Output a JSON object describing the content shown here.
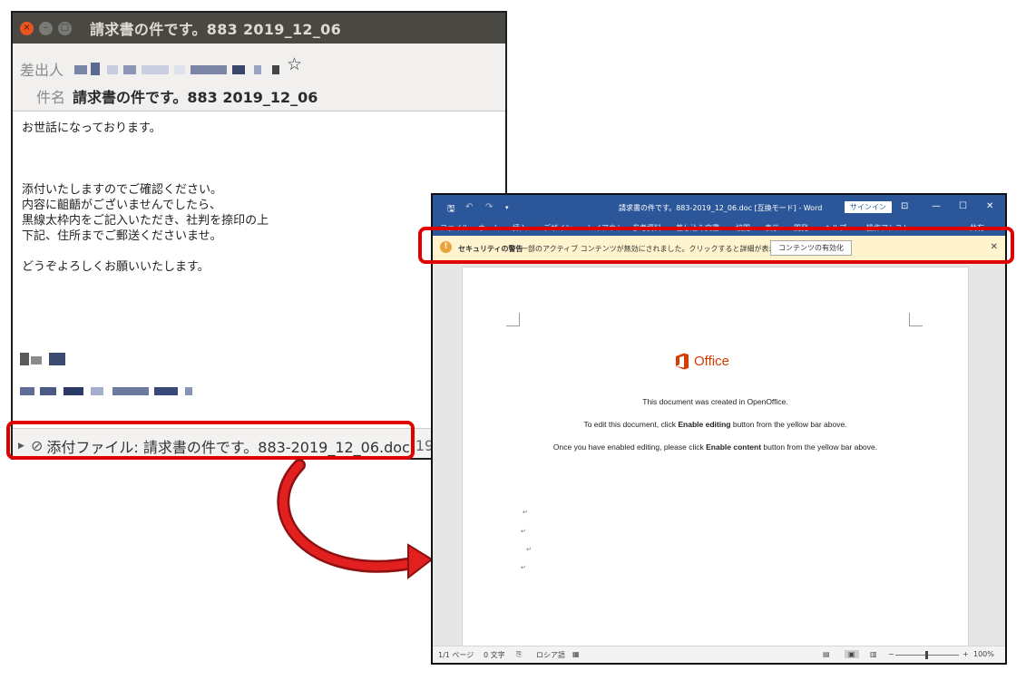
{
  "email": {
    "title": "請求書の件です。883 2019_12_06",
    "from_label": "差出人",
    "subject_label": "件名",
    "subject_value": "請求書の件です。883 2019_12_06",
    "body_lines": [
      "お世話になっております。",
      "",
      "",
      "添付いたしますのでご確認ください。",
      "内容に齟齬がございませんでしたら、",
      "黒線太枠内をご記入いただき、社判を捺印の上",
      "下記、住所までご郵送くださいませ。",
      "",
      "どうぞよろしくお願いいたします。"
    ],
    "attachment_label": "添付ファイル: 請求書の件です。883-2019_12_06.doc",
    "attachment_size": "19"
  },
  "word": {
    "title": "請求書の件です。883-2019_12_06.doc [互換モード] - Word",
    "signin": "サインイン",
    "ribbon_tabs": [
      "ファイル",
      "ホーム",
      "挿入",
      "デザイン",
      "レイアウト",
      "参考資料",
      "差し込み文書",
      "校閲",
      "表示",
      "開発",
      "ヘルプ",
      "操作アシスト",
      "共有"
    ],
    "security_title": "セキュリティの警告",
    "security_message": "一部のアクティブ コンテンツが無効にされました。クリックすると詳細が表示されます。",
    "enable_button": "コンテンツの有効化",
    "office_brand": "Office",
    "doc_line1": "This document was created in OpenOffice.",
    "doc_line2_a": "To edit this document, click ",
    "doc_line2_b": "Enable editing",
    "doc_line2_c": " button from the yellow bar above.",
    "doc_line3_a": "Once you have enabled editing, please click ",
    "doc_line3_b": "Enable content",
    "doc_line3_c": " button from the yellow bar above.",
    "para_mark": "↵",
    "status_page": "1/1 ページ",
    "status_words": "0 文字",
    "status_lang": "ロシア語",
    "status_zoom": "100%",
    "zoom_level_percent": 100
  },
  "colors": {
    "highlight_red": "#e00000",
    "word_blue": "#2b579a",
    "office_orange": "#d83b01",
    "security_yellow": "#fff4ce"
  }
}
